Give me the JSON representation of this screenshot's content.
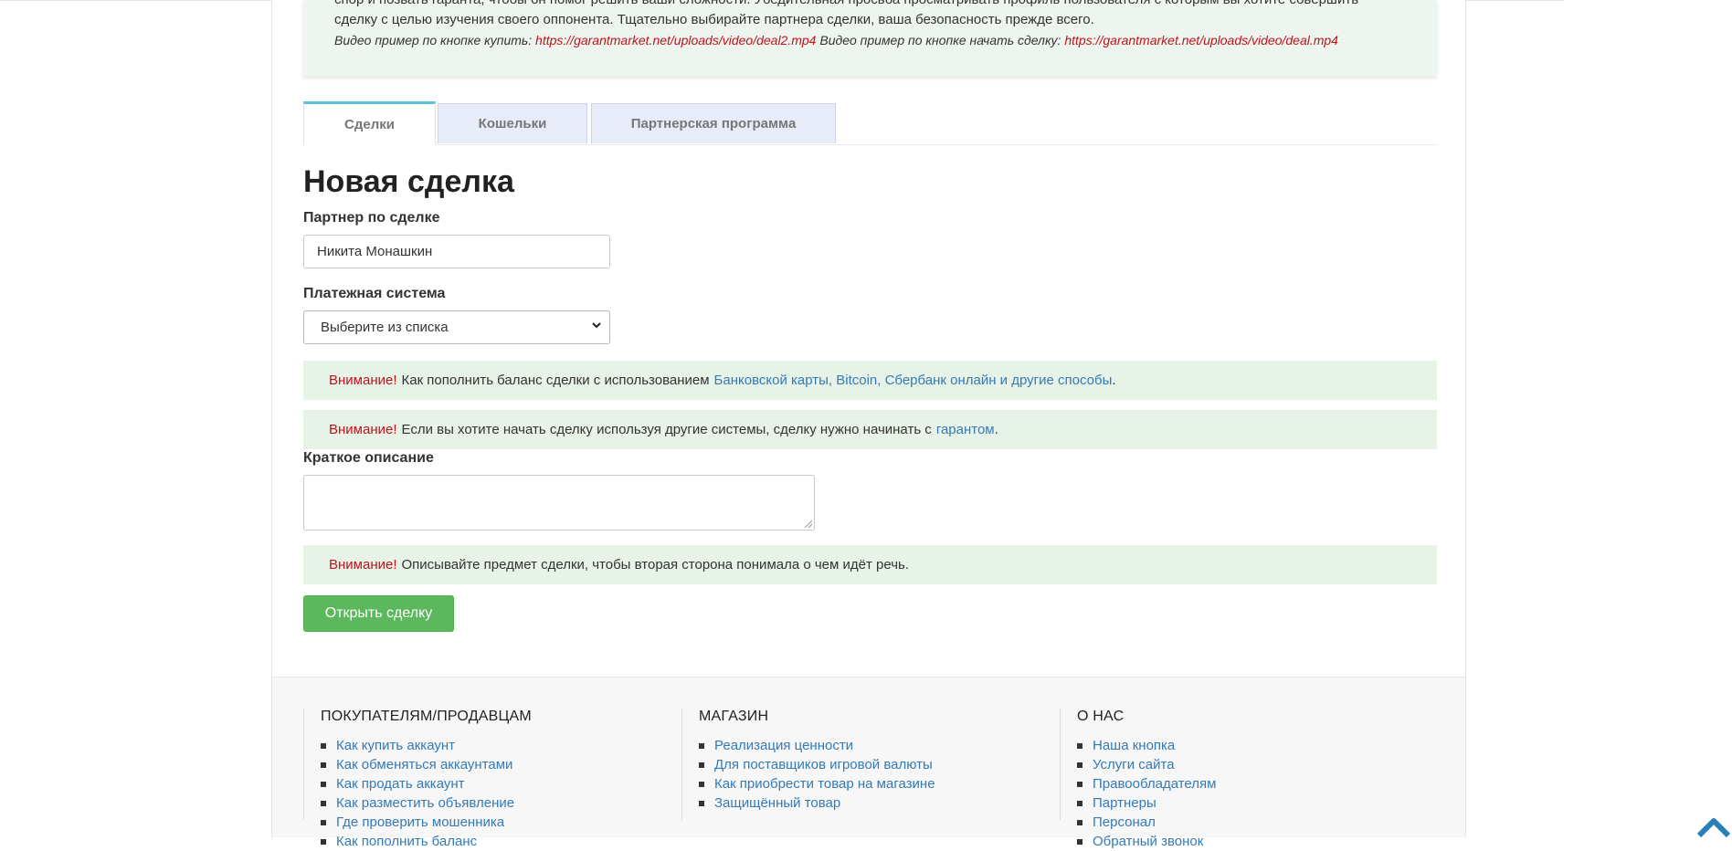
{
  "info": {
    "line1": "спор и позвать гаранта, чтобы он помог решить ваши сложности. Убедительная просьба просматривать профиль пользователя с которым вы хотите совершить",
    "line2": "сделку с целью изучения своего оппонента. Тщательно выбирайте партнера сделки, ваша безопасность прежде всего.",
    "video_buy_label": "Видео пример по кнопке купить:",
    "video_buy_url": "https://garantmarket.net/uploads/video/deal2.mp4",
    "video_deal_label": "Видео пример по кнопке начать сделку:",
    "video_deal_url": "https://garantmarket.net/uploads/video/deal.mp4"
  },
  "tabs": [
    {
      "label": "Сделки",
      "active": true
    },
    {
      "label": "Кошельки",
      "active": false
    },
    {
      "label": "Партнерская программа",
      "active": false
    }
  ],
  "form": {
    "title": "Новая сделка",
    "partner_label": "Партнер по сделке",
    "partner_value": "Никита Монашкин",
    "payment_label": "Платежная система",
    "payment_selected": "Выберите из списка",
    "description_label": "Краткое описание",
    "description_value": "",
    "submit_label": "Открыть сделку"
  },
  "alerts": [
    {
      "warn": "Внимание!",
      "text": "Как пополнить баланс сделки с использованием",
      "link": "Банковской карты, Bitcoin, Сбербанк онлайн и другие способы",
      "tail": "."
    },
    {
      "warn": "Внимание!",
      "text": "Если вы хотите начать сделку используя другие системы, сделку нужно начинать с",
      "link": "гарантом",
      "tail": "."
    },
    {
      "warn": "Внимание!",
      "text": "Описывайте предмет сделки, чтобы вторая сторона понимала о чем идёт речь.",
      "link": "",
      "tail": ""
    }
  ],
  "footer": {
    "columns": [
      {
        "title": "ПОКУПАТЕЛЯМ/ПРОДАВЦАМ",
        "items": [
          "Как купить аккаунт",
          "Как обменяться аккаунтами",
          "Как продать аккаунт",
          "Как разместить объявление",
          "Где проверить мошенника",
          "Как пополнить баланс"
        ]
      },
      {
        "title": "МАГАЗИН",
        "items": [
          "Реализация ценности",
          "Для поставщиков игровой валюты",
          "Как приобрести товар на магазине",
          "Защищённый товар"
        ]
      },
      {
        "title": "О НАС",
        "items": [
          "Наша кнопка",
          "Услуги сайта",
          "Правообладателям",
          "Партнеры",
          "Персонал",
          "Обратный звонок"
        ]
      }
    ]
  },
  "colors": {
    "accent_red": "#c0121c",
    "link_blue": "#337ab7",
    "button_green": "#5cb85c",
    "tab_active_top": "#5bc0de"
  },
  "icons": {
    "scroll_top": "chevron-up-icon",
    "select_arrow": "chevron-down-icon"
  }
}
